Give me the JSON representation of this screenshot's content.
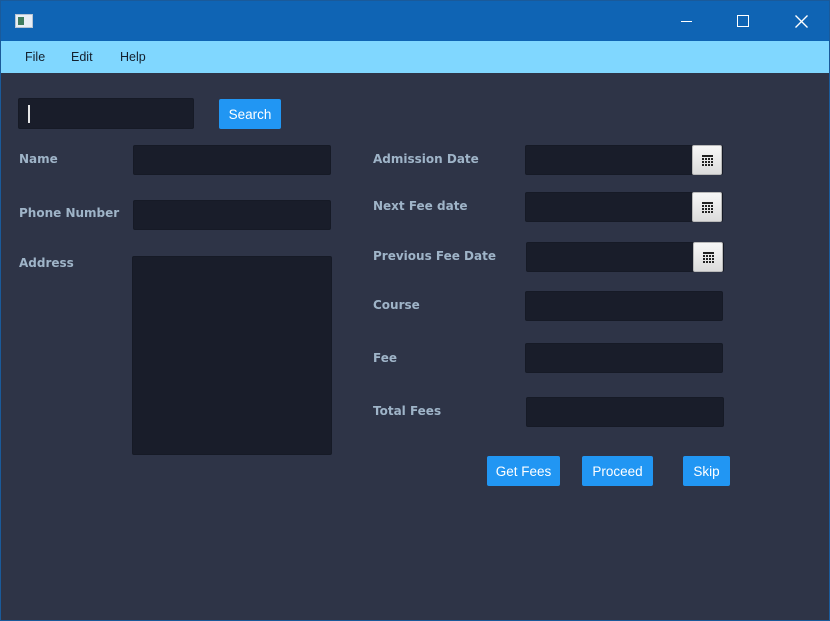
{
  "window": {
    "title": "",
    "controls": {
      "minimize": "minimize",
      "maximize": "maximize",
      "close": "close"
    }
  },
  "menu": {
    "items": [
      {
        "label": "File"
      },
      {
        "label": "Edit"
      },
      {
        "label": "Help"
      }
    ]
  },
  "search": {
    "value": "",
    "button_label": "Search"
  },
  "form_left": {
    "name_label": "Name",
    "phone_label": "Phone Number",
    "address_label": "Address"
  },
  "form_right": {
    "admission_date_label": "Admission Date",
    "next_fee_date_label": "Next Fee date",
    "previous_fee_date_label": "Previous Fee Date",
    "course_label": "Course",
    "fee_label": "Fee",
    "total_fees_label": "Total Fees"
  },
  "actions": {
    "get_fees": "Get Fees",
    "proceed": "Proceed",
    "skip": "Skip"
  },
  "icons": {
    "app": "app-icon",
    "calendar": "calendar-icon"
  },
  "colors": {
    "titlebar": "#0f64b4",
    "menubar": "#80d7ff",
    "background": "#2e3447",
    "field": "#191d2a",
    "accent": "#2196f3",
    "label": "#9fb4c8"
  }
}
